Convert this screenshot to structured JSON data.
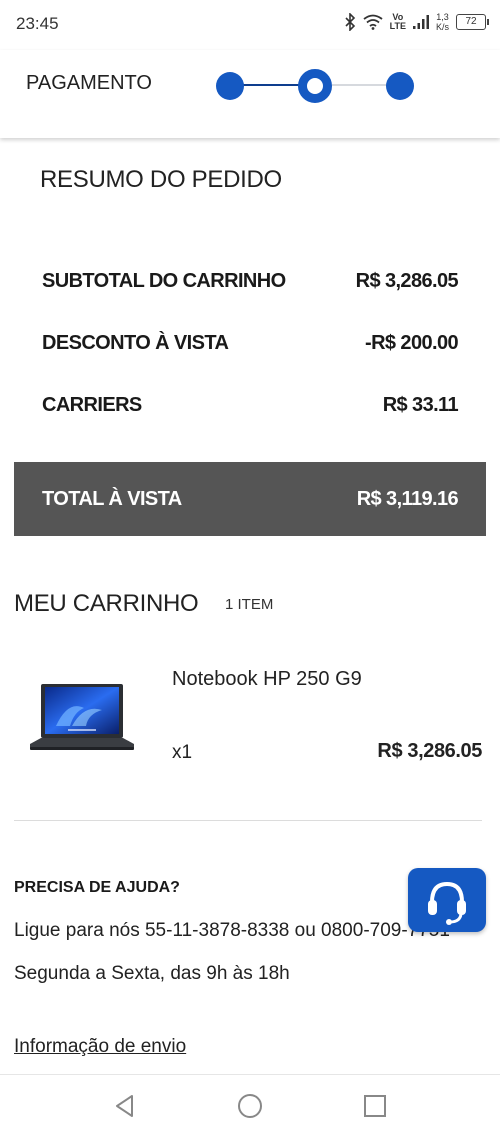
{
  "status_bar": {
    "time": "23:45",
    "lte_top": "Vo",
    "lte_bottom": "LTE",
    "speed_value": "1,3",
    "speed_unit": "K/s",
    "battery": "72",
    "icons": [
      "bluetooth-icon",
      "wifi-icon",
      "signal-icon",
      "battery-icon"
    ]
  },
  "header": {
    "title": "PAGAMENTO",
    "steps_total": 3,
    "current_step": 2
  },
  "summary": {
    "title": "RESUMO DO PEDIDO",
    "rows": [
      {
        "label": "SUBTOTAL DO CARRINHO",
        "value": "R$ 3,286.05"
      },
      {
        "label": "DESCONTO À VISTA",
        "value": "-R$ 200.00"
      },
      {
        "label": "CARRIERS",
        "value": "R$ 33.11"
      }
    ],
    "total_label": "TOTAL À VISTA",
    "total_value": "R$ 3,119.16"
  },
  "cart": {
    "title": "MEU CARRINHO",
    "count": "1 ITEM",
    "items": [
      {
        "name": "Notebook HP 250 G9",
        "qty": "x1",
        "price": "R$ 3,286.05",
        "image_icon": "laptop-image"
      }
    ]
  },
  "help": {
    "title": "PRECISA DE AJUDA?",
    "phone_line": "Ligue para nós 55-11-3878-8338 ou 0800-709-7751",
    "hours_line": "Segunda a Sexta, das 9h às 18h",
    "shipping_link": "Informação de envio"
  },
  "colors": {
    "accent": "#1559c2",
    "total_bar": "#555555",
    "text": "#222222"
  }
}
